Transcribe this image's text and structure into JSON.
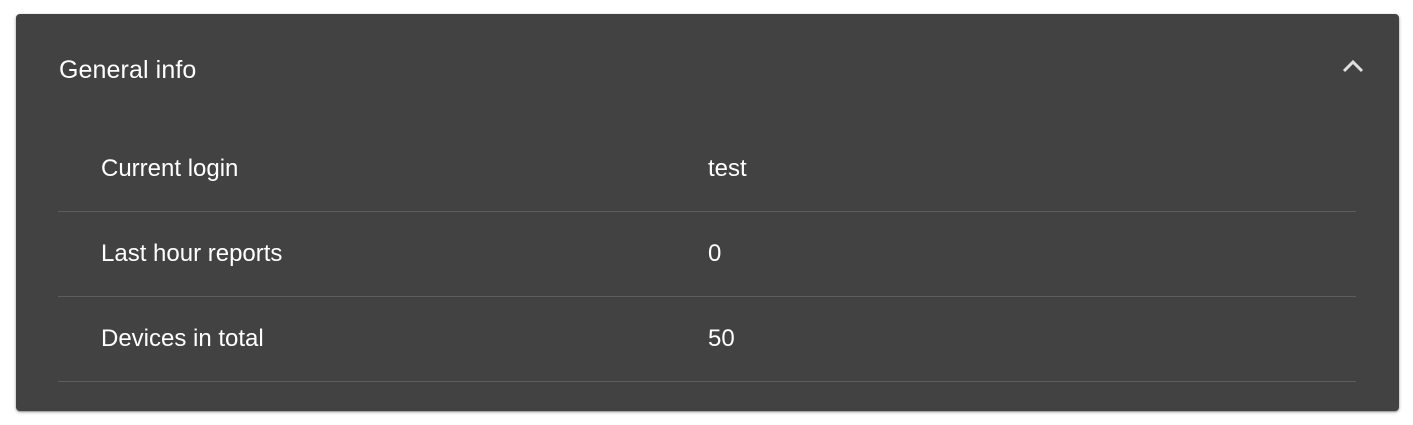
{
  "panel": {
    "title": "General info",
    "collapse_icon": "chevron-up-icon",
    "colors": {
      "panel_background": "#424242",
      "text": "#ffffff",
      "divider": "#5d5d5d"
    }
  },
  "rows": [
    {
      "label": "Current login",
      "value": "test"
    },
    {
      "label": "Last hour reports",
      "value": "0"
    },
    {
      "label": "Devices in total",
      "value": "50"
    }
  ]
}
